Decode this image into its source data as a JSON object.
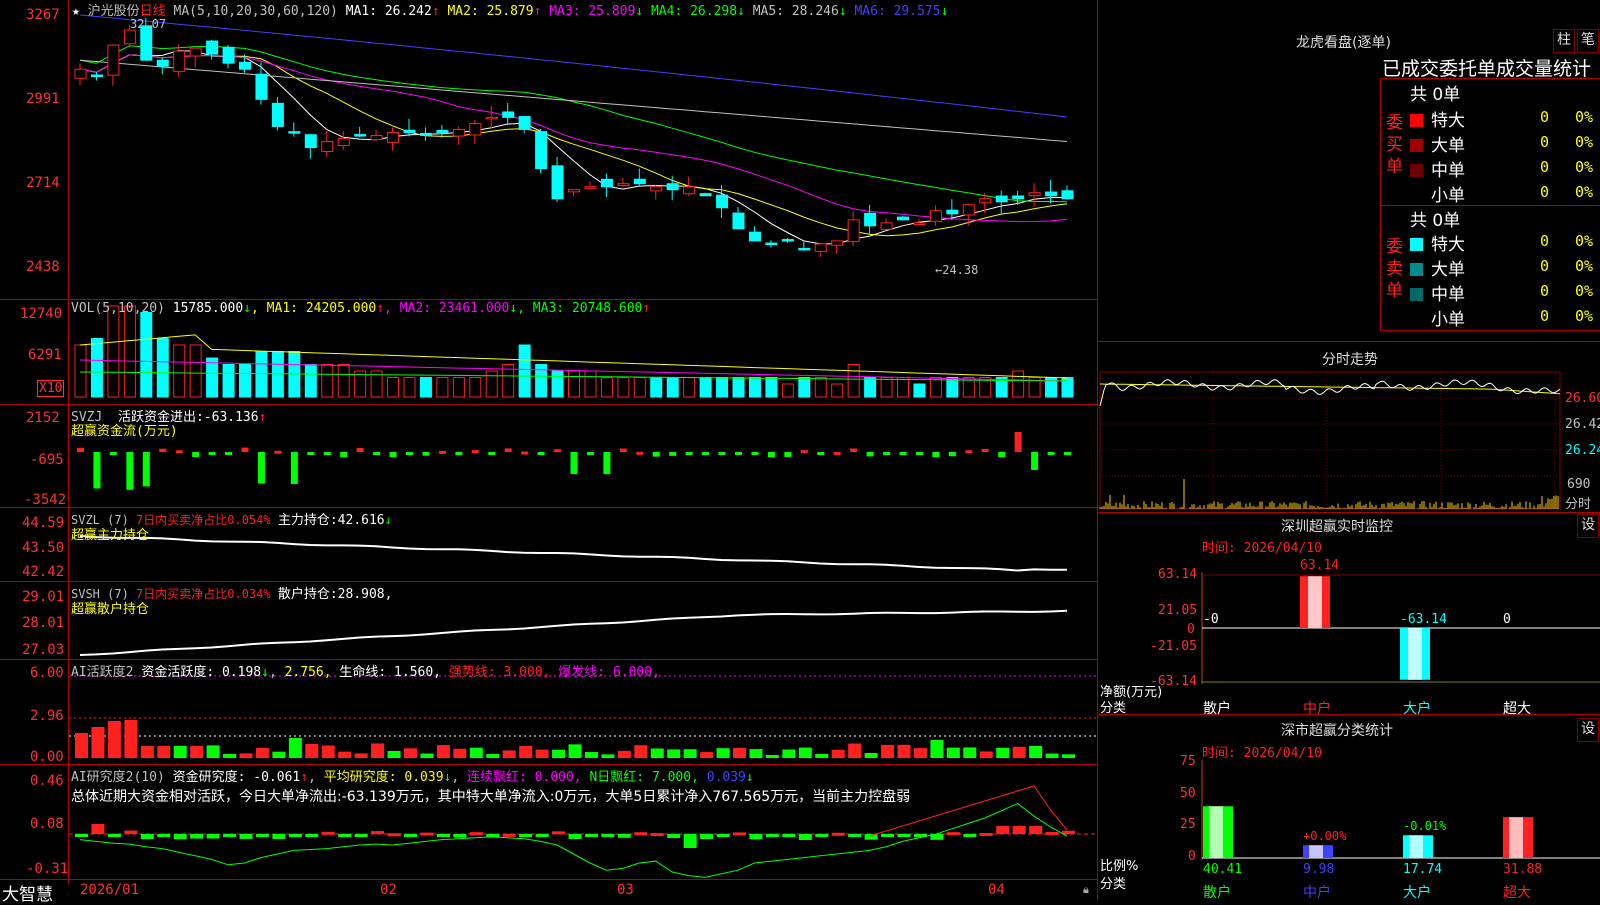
{
  "colors": {
    "up": "#ff2020",
    "down": "#00ffff",
    "frame": "#b00000",
    "ma1": "#ffffff",
    "ma2": "#ffff00",
    "ma3": "#ff00ff",
    "ma4": "#00ff00",
    "ma5": "#c0c0c0",
    "ma6": "#4040ff"
  },
  "main": {
    "star": "★",
    "stock_name": "沪光股份",
    "period": "日线",
    "ma_title": "MA(5,10,20,30,60,120)",
    "ma": [
      {
        "label": "MA1:",
        "value": "26.242",
        "arrow": "↑",
        "color": "#ffffff"
      },
      {
        "label": "MA2:",
        "value": "25.879",
        "arrow": "↑",
        "color": "#ffff00"
      },
      {
        "label": "MA3:",
        "value": "25.809",
        "arrow": "↓",
        "color": "#ff00ff"
      },
      {
        "label": "MA4:",
        "value": "26.298",
        "arrow": "↓",
        "color": "#00ff00"
      },
      {
        "label": "MA5:",
        "value": "28.246",
        "arrow": "↓",
        "color": "#c0c0c0"
      },
      {
        "label": "MA6:",
        "value": "29.575",
        "arrow": "↓",
        "color": "#4040ff"
      }
    ],
    "y_ticks": [
      "3267",
      "2991",
      "2714",
      "2438"
    ],
    "high_marker": "32.07",
    "low_marker": "←24.38"
  },
  "volume": {
    "title": "VOL(5,10,20)",
    "value": "15785.000",
    "value_arrow": "↓",
    "ma": [
      {
        "label": "MA1:",
        "value": "24205.000",
        "arrow": "↑",
        "color": "#ffff00"
      },
      {
        "label": "MA2:",
        "value": "23461.000",
        "arrow": "↓",
        "color": "#ff00ff"
      },
      {
        "label": "MA3:",
        "value": "20748.600",
        "arrow": "↑",
        "color": "#00ff00"
      }
    ],
    "y_ticks": [
      "12740",
      "6291"
    ],
    "unit": "X10"
  },
  "svzj": {
    "title": "SVZJ",
    "label": "活跃资金进出:",
    "value": "-63.136",
    "arrow": "↑",
    "sub": "超赢资金流(万元)",
    "y_ticks": [
      "2152",
      "-695",
      "-3542"
    ]
  },
  "svzl": {
    "title": "SVZL (7)",
    "ratio": "7日内买卖净占比0.054%",
    "label": "主力持仓:",
    "value": "42.616",
    "arrow": "↓",
    "sub": "超赢主力持仓",
    "y_ticks": [
      "44.59",
      "43.50",
      "42.42"
    ]
  },
  "svsh": {
    "title": "SVSH (7)",
    "ratio": "7日内买卖净占比0.034%",
    "label": "散户持仓:",
    "value": "28.908,",
    "sub": "超赢散户持仓",
    "y_ticks": [
      "29.01",
      "28.01",
      "27.03"
    ]
  },
  "ai_active": {
    "title": "AI活跃度2",
    "l1": "资金活跃度:",
    "v1": "0.198",
    "a1": "↓",
    "v1b": "2.756,",
    "l2": "生命线:",
    "v2": "1.560,",
    "l3": "强势线:",
    "v3": "3.000,",
    "l4": "爆发线:",
    "v4": "6.000,",
    "y_ticks": [
      "6.00",
      "2.96",
      "0.00"
    ]
  },
  "ai_research": {
    "title": "AI研究度2(10)",
    "l1": "资金研究度:",
    "v1": "-0.061",
    "a1": "↑",
    "l2": "平均研究度:",
    "v2": "0.039",
    "a2": "↓",
    "l3": "连续飘红:",
    "v3": "0.000,",
    "l4": "N日飘红:",
    "v4": "7.000,",
    "v5": "0.039",
    "a5": "↓",
    "summary": "总体近期大资金相对活跃，今日大单净流出:-63.139万元，其中特大单净流入:0万元，大单5日累计净入767.565万元，当前主力控盘弱",
    "y_ticks": [
      "0.46",
      "0.08",
      "-0.31"
    ]
  },
  "x_axis": {
    "brand": "大智慧",
    "labels": [
      "2026/01",
      "02",
      "03",
      "04"
    ]
  },
  "right": {
    "dragon_title": "龙虎看盘(逐单)",
    "btn_zhu": "柱",
    "btn_bi": "笔",
    "order_header": "已成交委托单成交量统计",
    "buy_label": "委买单",
    "sell_label": "委卖单",
    "buy_total": "共 0单",
    "sell_total": "共 0单",
    "buy_rows": [
      {
        "name": "特大",
        "count": "0",
        "pct": "0%",
        "color": "#ff0000"
      },
      {
        "name": "大单",
        "count": "0",
        "pct": "0%",
        "color": "#a00000"
      },
      {
        "name": "中单",
        "count": "0",
        "pct": "0%",
        "color": "#700000"
      },
      {
        "name": "小单",
        "count": "0",
        "pct": "0%",
        "color": "#000000"
      }
    ],
    "sell_rows": [
      {
        "name": "特大",
        "count": "0",
        "pct": "0%",
        "color": "#00ffff"
      },
      {
        "name": "大单",
        "count": "0",
        "pct": "0%",
        "color": "#008c8c"
      },
      {
        "name": "中单",
        "count": "0",
        "pct": "0%",
        "color": "#006a6a"
      },
      {
        "name": "小单",
        "count": "0",
        "pct": "0%",
        "color": "#000000"
      }
    ],
    "intraday_title": "分时走势",
    "intraday_ticks": [
      "26.60",
      "26.42",
      "26.24"
    ],
    "intraday_vol": "690",
    "intraday_label": "分时",
    "monitor_title": "深圳超赢实时监控",
    "monitor_set": "设",
    "monitor_time": "时间: 2026/04/10",
    "monitor_ticks": [
      "63.14",
      "21.05",
      "0",
      "-21.05",
      "-63.14"
    ],
    "monitor_unit": "净额(万元)",
    "monitor_cat": "分类",
    "monitor_values": [
      {
        "cat": "散户",
        "value": "-0",
        "num": 0,
        "color": "#ffffff"
      },
      {
        "cat": "中户",
        "value": "63.14",
        "num": 63.14,
        "color": "#ff2020"
      },
      {
        "cat": "大户",
        "value": "-63.14",
        "num": -63.14,
        "color": "#00ffff"
      },
      {
        "cat": "超大",
        "value": "0",
        "num": 0,
        "color": "#ffffff"
      }
    ],
    "class_title": "深市超赢分类统计",
    "class_set": "设",
    "class_time": "时间: 2026/04/10",
    "class_ticks": [
      "75",
      "50",
      "25",
      "0"
    ],
    "class_unit": "比例%",
    "class_cat": "分类",
    "class_values": [
      {
        "cat": "散户",
        "pct": 40.41,
        "label": "40.41",
        "delta": "",
        "color": "#00ff00"
      },
      {
        "cat": "中户",
        "pct": 9.98,
        "label": "9.98",
        "delta": "+0.00%",
        "color": "#4040ff"
      },
      {
        "cat": "大户",
        "pct": 17.74,
        "label": "17.74",
        "delta": "-0.01%",
        "color": "#00ffff"
      },
      {
        "cat": "超大",
        "pct": 31.88,
        "label": "31.88",
        "delta": "",
        "color": "#ff2020"
      }
    ],
    "class_cats": [
      "散户",
      "中户",
      "大户",
      "超大"
    ],
    "class_cat_colors": [
      "#00ff00",
      "#4040ff",
      "#00ffff",
      "#ff2020"
    ]
  }
}
